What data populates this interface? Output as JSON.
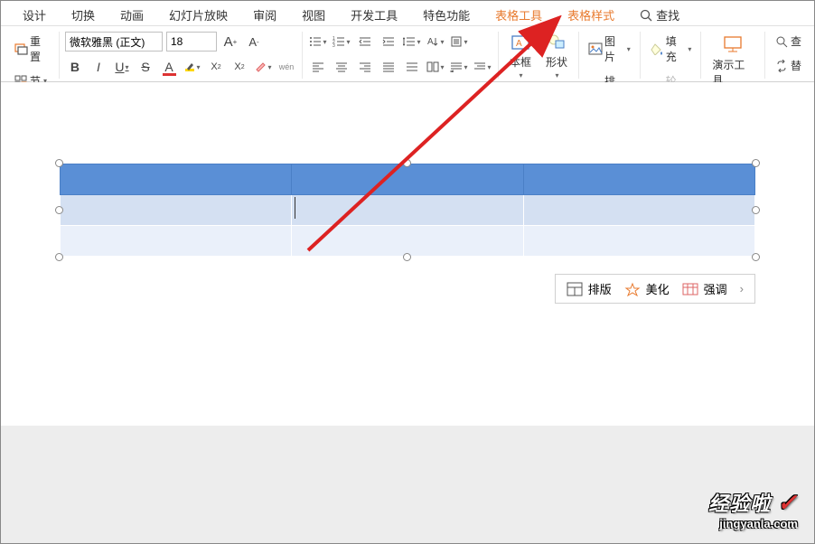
{
  "tabs": {
    "design": "设计",
    "transition": "切换",
    "animation": "动画",
    "slideshow": "幻灯片放映",
    "review": "审阅",
    "view": "视图",
    "devtools": "开发工具",
    "special": "特色功能",
    "table_tools": "表格工具",
    "table_style": "表格样式",
    "search": "查找"
  },
  "toolbar": {
    "reset": "重置",
    "section": "节",
    "font_name": "微软雅黑 (正文)",
    "font_size": "18",
    "textbox": "本框",
    "shape": "形状",
    "picture": "图片",
    "fill": "填充",
    "arrange": "排列",
    "outline": "轮廓",
    "present_tools": "演示工具",
    "find2": "查",
    "replace": "替"
  },
  "float_toolbar": {
    "layout": "排版",
    "beautify": "美化",
    "emphasis": "强调"
  },
  "watermark": {
    "top": "经验啦",
    "bottom": "jingyanla.com"
  },
  "chart_data": {
    "type": "table",
    "rows": 3,
    "cols": 3,
    "style": "blue-banded-header",
    "header_bg": "#5a8fd6",
    "alt_row_bg": "#d4e0f2",
    "row_bg": "#eaf0fa"
  }
}
